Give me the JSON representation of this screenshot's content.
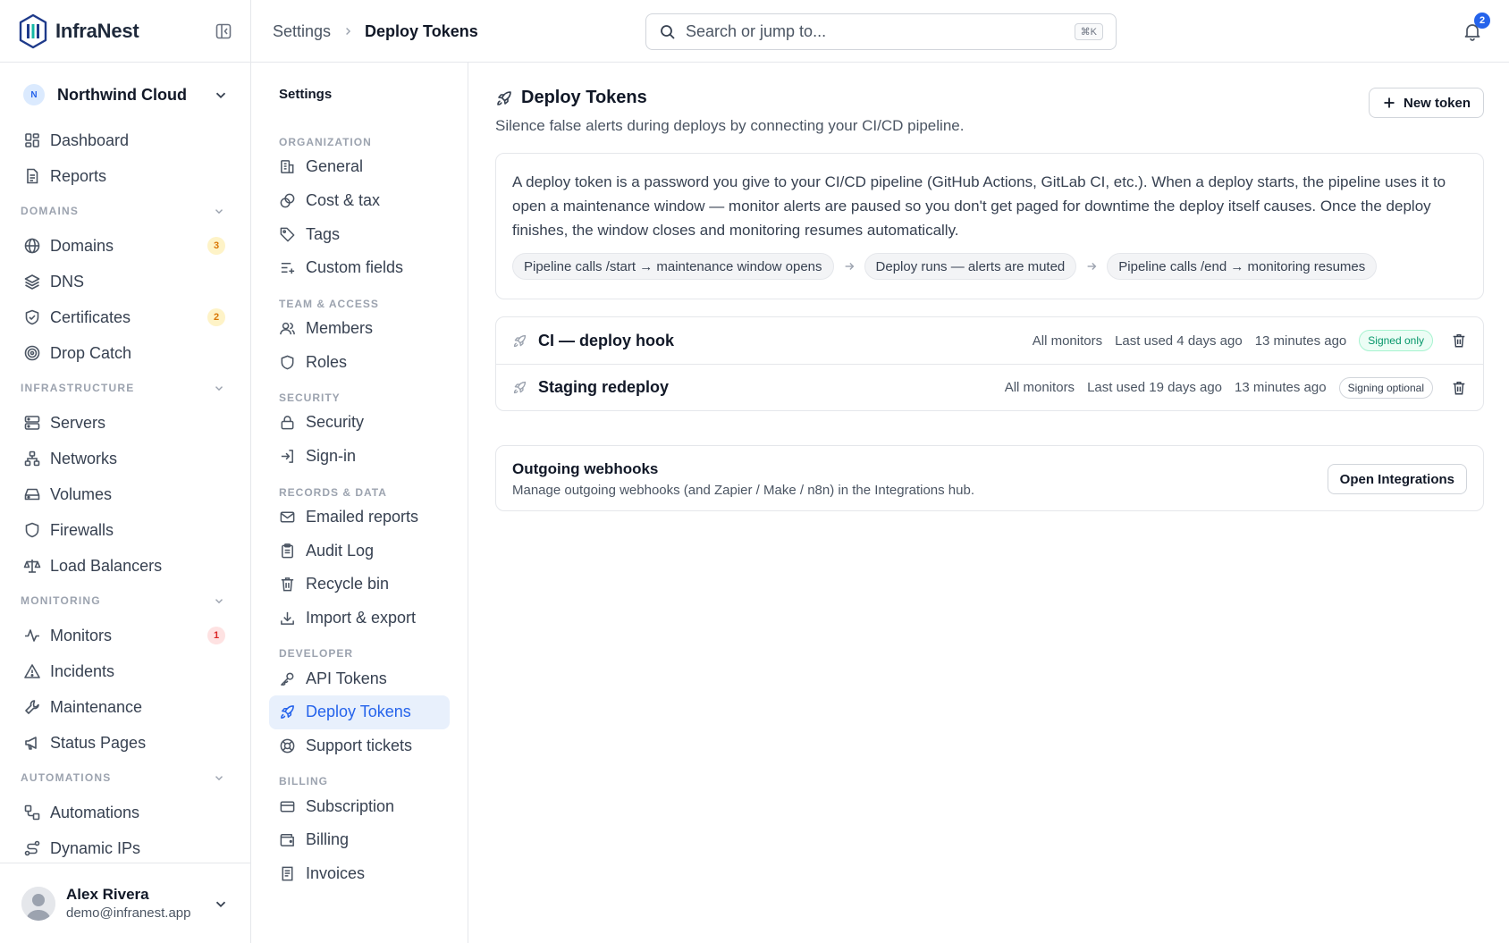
{
  "app": {
    "name": "InfraNest"
  },
  "org": {
    "initial": "N",
    "name": "Northwind Cloud"
  },
  "sidebar": {
    "top_items": [
      {
        "label": "Dashboard"
      },
      {
        "label": "Reports"
      }
    ],
    "sections": [
      {
        "title": "DOMAINS",
        "items": [
          {
            "label": "Domains",
            "badge": "3"
          },
          {
            "label": "DNS"
          },
          {
            "label": "Certificates",
            "badge": "2"
          },
          {
            "label": "Drop Catch"
          }
        ]
      },
      {
        "title": "INFRASTRUCTURE",
        "items": [
          {
            "label": "Servers"
          },
          {
            "label": "Networks"
          },
          {
            "label": "Volumes"
          },
          {
            "label": "Firewalls"
          },
          {
            "label": "Load Balancers"
          }
        ]
      },
      {
        "title": "MONITORING",
        "items": [
          {
            "label": "Monitors",
            "badge": "1"
          },
          {
            "label": "Incidents"
          },
          {
            "label": "Maintenance"
          },
          {
            "label": "Status Pages"
          }
        ]
      },
      {
        "title": "AUTOMATIONS",
        "items": [
          {
            "label": "Automations"
          },
          {
            "label": "Dynamic IPs"
          }
        ]
      }
    ],
    "colors": {
      "badge_amber": "#d97706",
      "badge_red": "#dc2626"
    }
  },
  "user": {
    "name": "Alex Rivera",
    "email": "demo@infranest.app"
  },
  "topbar": {
    "breadcrumb_root": "Settings",
    "breadcrumb_current": "Deploy Tokens",
    "search_placeholder": "Search or jump to...",
    "search_shortcut": "⌘K",
    "notification_count": "2"
  },
  "settings_nav": {
    "title": "Settings",
    "sections": [
      {
        "title": "ORGANIZATION",
        "items": [
          "General",
          "Cost & tax",
          "Tags",
          "Custom fields"
        ]
      },
      {
        "title": "TEAM & ACCESS",
        "items": [
          "Members",
          "Roles"
        ]
      },
      {
        "title": "SECURITY",
        "items": [
          "Security",
          "Sign-in"
        ]
      },
      {
        "title": "RECORDS & DATA",
        "items": [
          "Emailed reports",
          "Audit Log",
          "Recycle bin",
          "Import & export"
        ]
      },
      {
        "title": "DEVELOPER",
        "items": [
          "API Tokens",
          "Deploy Tokens",
          "Support tickets"
        ]
      },
      {
        "title": "BILLING",
        "items": [
          "Subscription",
          "Billing",
          "Invoices"
        ]
      }
    ],
    "active_item": "Deploy Tokens",
    "accent_color": "#2563eb"
  },
  "main": {
    "title": "Deploy Tokens",
    "subtitle": "Silence false alerts during deploys by connecting your CI/CD pipeline.",
    "new_token_label": "New token",
    "info": {
      "text": "A deploy token is a password you give to your CI/CD pipeline (GitHub Actions, GitLab CI, etc.). When a deploy starts, the pipeline uses it to open a maintenance window — monitor alerts are paused so you don't get paged for downtime the deploy itself causes. Once the deploy finishes, the window closes and monitoring resumes automatically.",
      "steps": [
        "Pipeline calls /start → maintenance window opens",
        "Deploy runs — alerts are muted",
        "Pipeline calls /end → monitoring resumes"
      ]
    },
    "tokens": [
      {
        "name": "CI — deploy hook",
        "scope": "All monitors",
        "last_used": "Last used 4 days ago",
        "created": "13 minutes ago",
        "signing": "Signed only",
        "signing_style": "green"
      },
      {
        "name": "Staging redeploy",
        "scope": "All monitors",
        "last_used": "Last used 19 days ago",
        "created": "13 minutes ago",
        "signing": "Signing optional",
        "signing_style": "gray"
      }
    ],
    "webhooks": {
      "title": "Outgoing webhooks",
      "description": "Manage outgoing webhooks (and Zapier / Make / n8n) in the Integrations hub.",
      "button_label": "Open Integrations"
    }
  }
}
